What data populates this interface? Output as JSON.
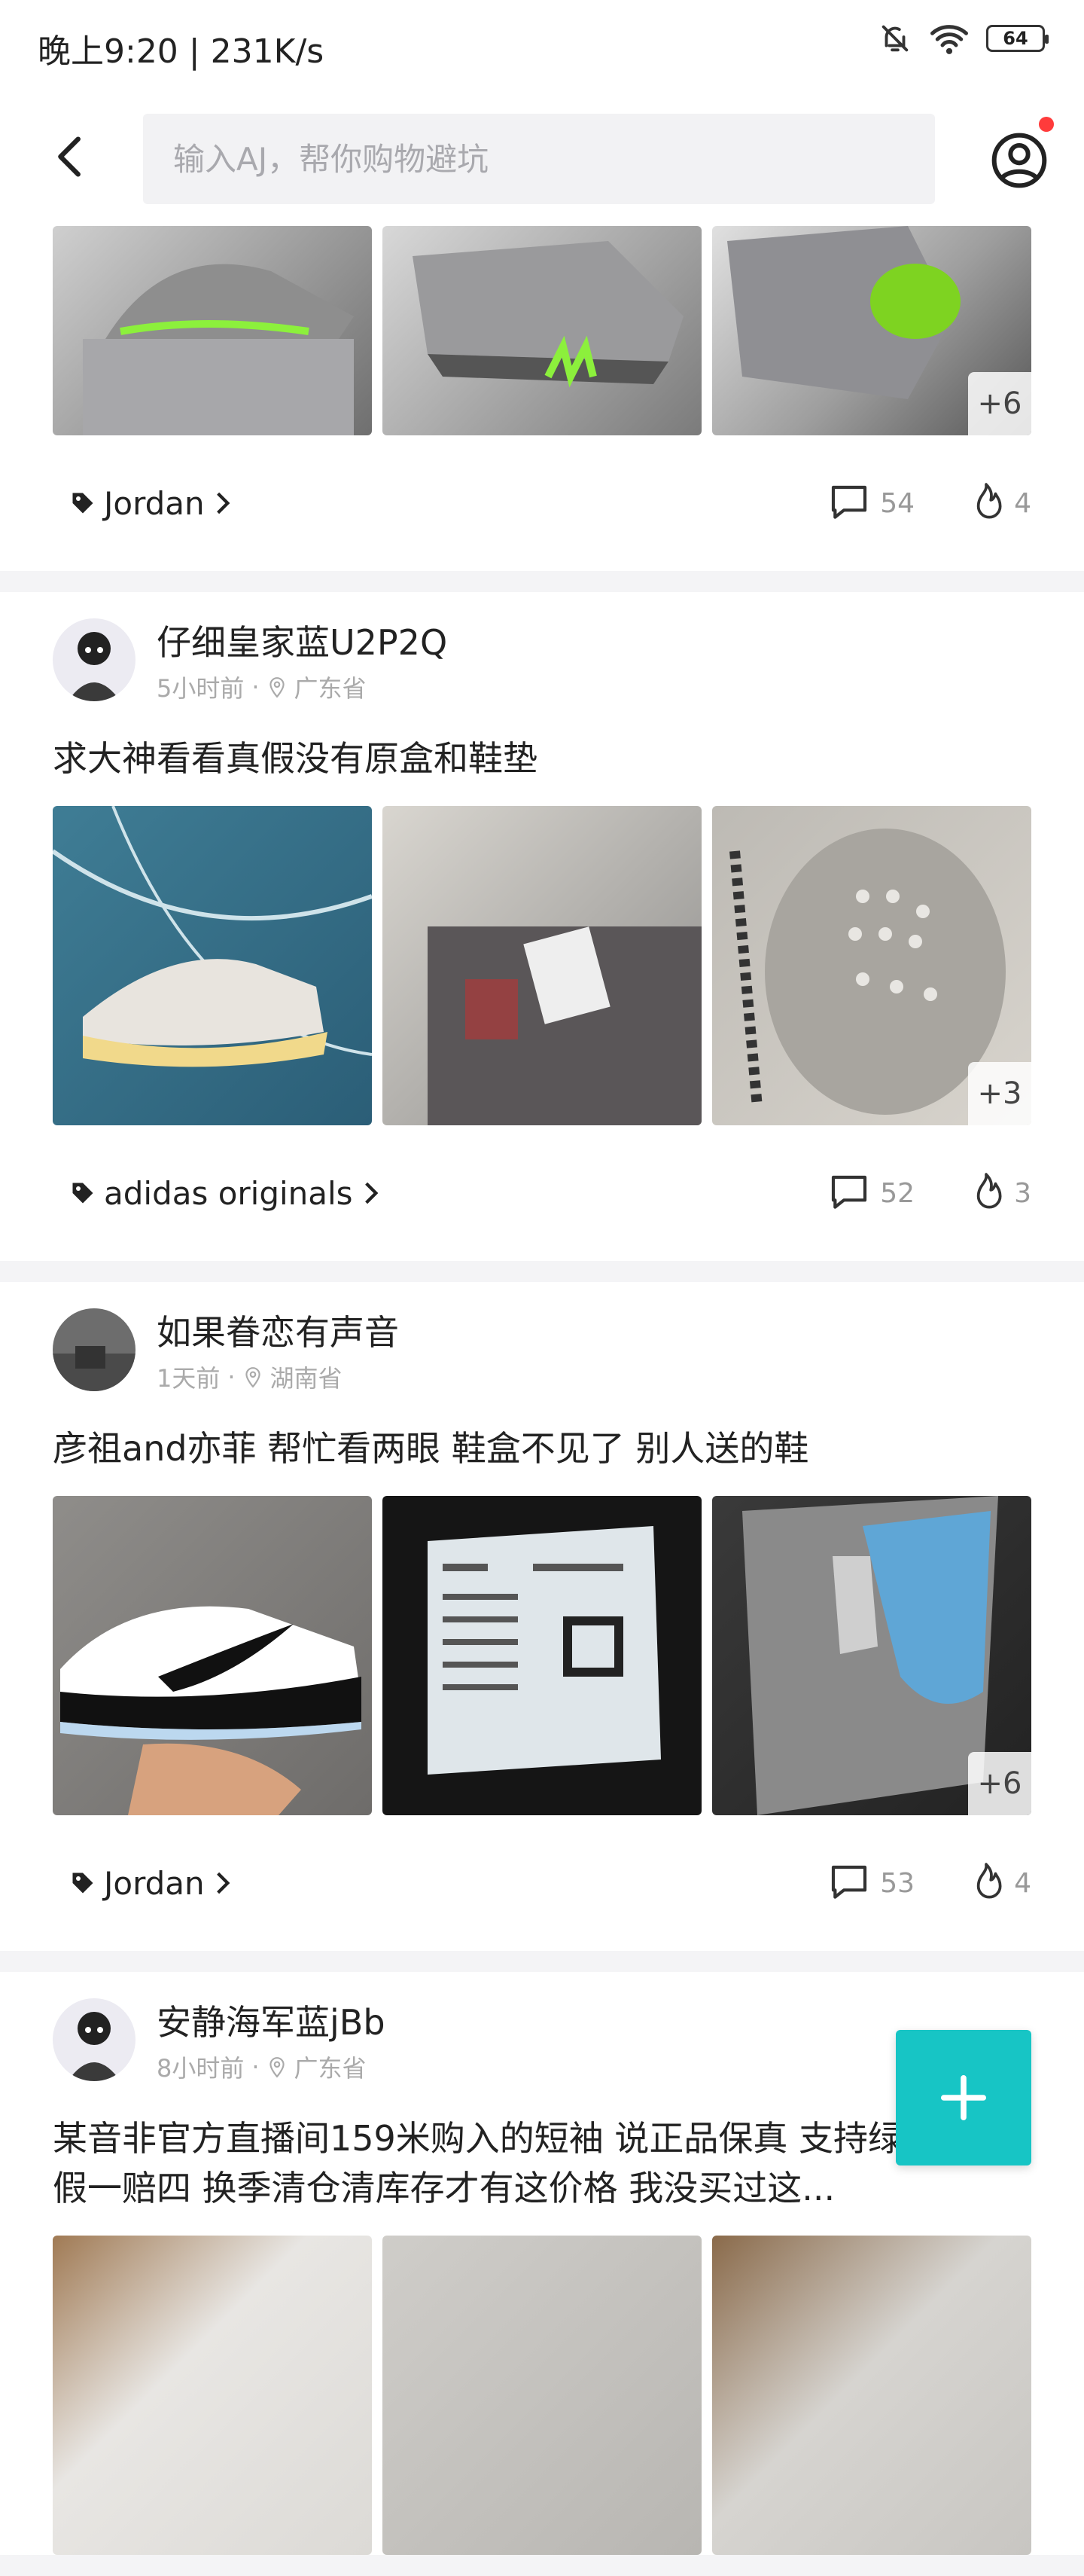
{
  "status_bar": {
    "time": "晚上9:20 | 231K/s",
    "battery": "64"
  },
  "search": {
    "placeholder": "输入AJ，帮你购物避坑"
  },
  "posts": [
    {
      "tag": "Jordan",
      "comments": "54",
      "likes": "4",
      "more_images": "+6"
    },
    {
      "username": "仔细皇家蓝U2P2Q",
      "time": "5小时前",
      "location": "广东省",
      "text": "求大神看看真假没有原盒和鞋垫",
      "more_images": "+3",
      "tag": "adidas originals",
      "comments": "52",
      "likes": "3"
    },
    {
      "username": "如果眷恋有声音",
      "time": "1天前",
      "location": "湖南省",
      "text": "彦祖and亦菲 帮忙看两眼 鞋盒不见了 别人送的鞋",
      "more_images": "+6",
      "tag": "Jordan",
      "comments": "53",
      "likes": "4"
    },
    {
      "username": "安静海军蓝jBb",
      "time": "8小时前",
      "location": "广东省",
      "text": "某音非官方直播间159米购入的短袖 说正品保真 支持绿叉鉴定 假一赔四 换季清仓清库存才有这价格 我没买过这..."
    }
  ],
  "colors": {
    "accent": "#17c5c5",
    "notification": "#ff3b3b"
  },
  "icons": [
    "bell-off-icon",
    "wifi-icon",
    "battery-icon",
    "back-arrow-icon",
    "profile-icon",
    "tag-icon",
    "chevron-right-icon",
    "comment-icon",
    "fire-icon",
    "location-pin-icon",
    "plus-icon"
  ]
}
